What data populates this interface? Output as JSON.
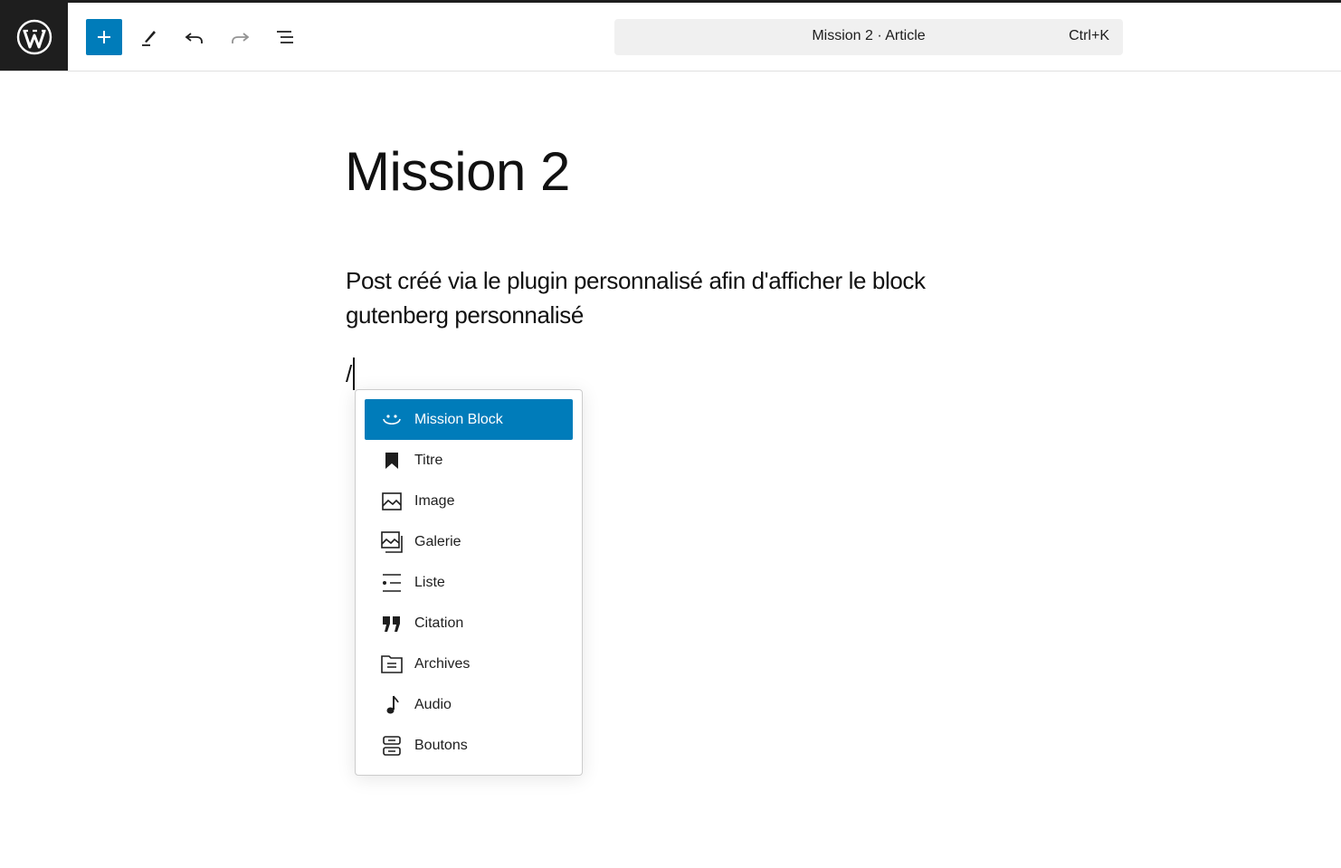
{
  "header": {
    "command_bar": {
      "title": "Mission 2 · Article",
      "shortcut": "Ctrl+K"
    }
  },
  "post": {
    "title": "Mission 2",
    "paragraph": "Post créé via le plugin personnalisé afin d'afficher le block gutenberg personnalisé",
    "slash_input": "/"
  },
  "autocomplete": {
    "items": [
      {
        "label": "Mission Block",
        "icon": "smiley-icon",
        "selected": true
      },
      {
        "label": "Titre",
        "icon": "bookmark-icon"
      },
      {
        "label": "Image",
        "icon": "image-icon"
      },
      {
        "label": "Galerie",
        "icon": "gallery-icon"
      },
      {
        "label": "Liste",
        "icon": "list-icon"
      },
      {
        "label": "Citation",
        "icon": "quote-icon"
      },
      {
        "label": "Archives",
        "icon": "archive-icon"
      },
      {
        "label": "Audio",
        "icon": "audio-icon"
      },
      {
        "label": "Boutons",
        "icon": "buttons-icon"
      }
    ]
  },
  "colors": {
    "accent": "#007cba",
    "dark": "#1e1e1e"
  }
}
